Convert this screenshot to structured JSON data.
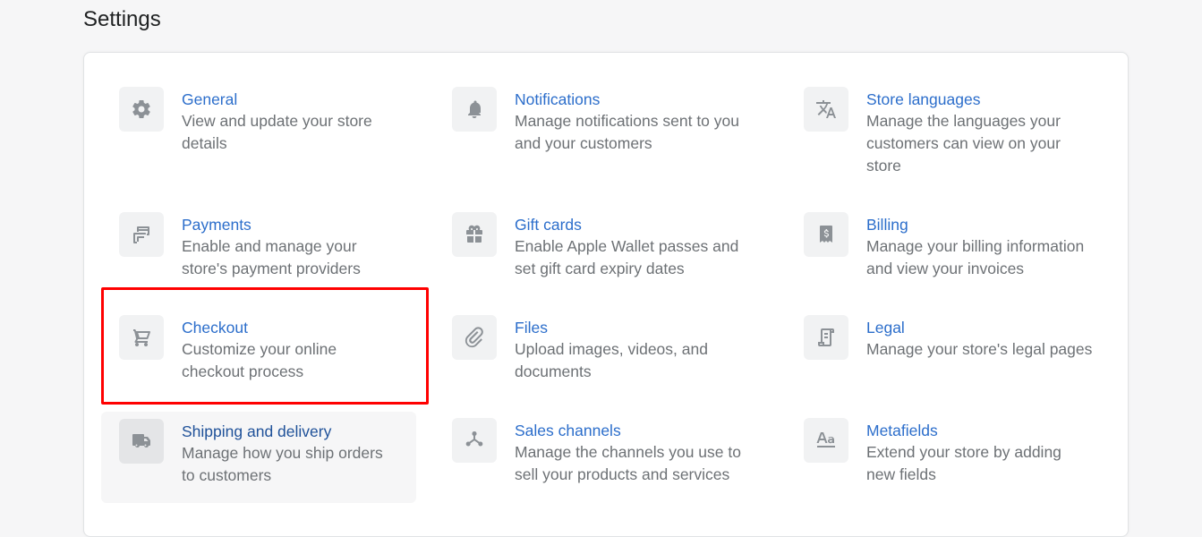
{
  "page": {
    "title": "Settings"
  },
  "settings": [
    {
      "title": "General",
      "description": "View and update your store details",
      "icon": "gear-icon"
    },
    {
      "title": "Notifications",
      "description": "Manage notifications sent to you and your customers",
      "icon": "bell-icon"
    },
    {
      "title": "Store languages",
      "description": "Manage the languages your customers can view on your store",
      "icon": "translate-icon"
    },
    {
      "title": "Payments",
      "description": "Enable and manage your store's payment providers",
      "icon": "payment-card-icon"
    },
    {
      "title": "Gift cards",
      "description": "Enable Apple Wallet passes and set gift card expiry dates",
      "icon": "gift-icon"
    },
    {
      "title": "Billing",
      "description": "Manage your billing information and view your invoices",
      "icon": "invoice-icon"
    },
    {
      "title": "Checkout",
      "description": "Customize your online checkout process",
      "icon": "cart-icon"
    },
    {
      "title": "Files",
      "description": "Upload images, videos, and documents",
      "icon": "paperclip-icon"
    },
    {
      "title": "Legal",
      "description": "Manage your store's legal pages",
      "icon": "document-icon"
    },
    {
      "title": "Shipping and delivery",
      "description": "Manage how you ship orders to customers",
      "icon": "truck-icon"
    },
    {
      "title": "Sales channels",
      "description": "Manage the channels you use to sell your products and services",
      "icon": "channels-icon"
    },
    {
      "title": "Metafields",
      "description": "Extend your store by adding new fields",
      "icon": "metafields-icon"
    }
  ],
  "colors": {
    "link": "#2c6ecb",
    "highlight": "#ff0000"
  }
}
